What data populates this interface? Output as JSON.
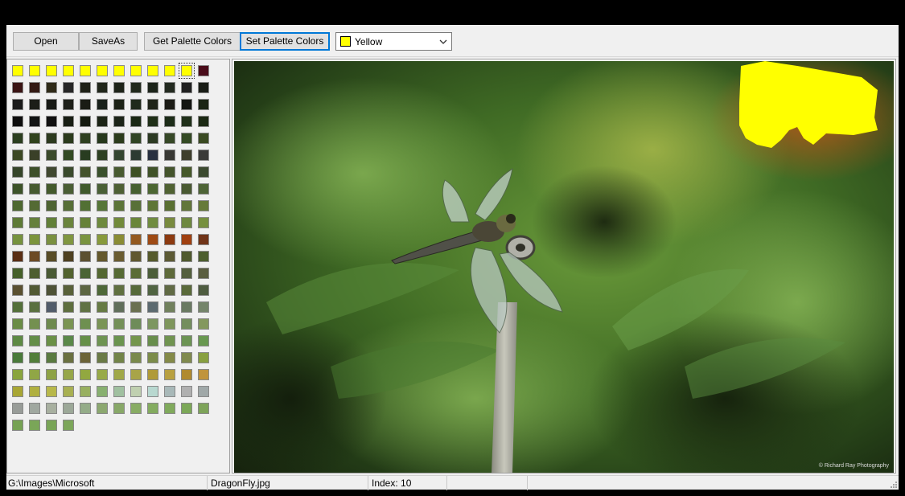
{
  "toolbar": {
    "open_label": "Open",
    "saveas_label": "SaveAs",
    "get_palette_label": "Get Palette Colors",
    "set_palette_label": "Set Palette Colors",
    "color_select": {
      "value": "Yellow",
      "swatch": "#ffff00",
      "icon": "chevron-down-icon"
    }
  },
  "palette": {
    "columns": 12,
    "selected_index": 10,
    "colors": [
      "#ffff00",
      "#ffff00",
      "#ffff00",
      "#ffff00",
      "#ffff00",
      "#ffff00",
      "#ffff00",
      "#ffff00",
      "#ffff00",
      "#ffff00",
      "#ffff00",
      "#4a0c1a",
      "#3a1414",
      "#341a14",
      "#2f2a18",
      "#262626",
      "#1f2117",
      "#20261a",
      "#1e2419",
      "#222a1c",
      "#1c241a",
      "#232a20",
      "#202020",
      "#191d16",
      "#1b1b1b",
      "#1c1e18",
      "#181a16",
      "#1e2019",
      "#1a1c15",
      "#18201a",
      "#1c2216",
      "#202a1c",
      "#1f2419",
      "#1c1c16",
      "#141612",
      "#1a2414",
      "#0e0e0e",
      "#121414",
      "#101010",
      "#181e14",
      "#141a10",
      "#1c2416",
      "#1c2418",
      "#1a2814",
      "#203018",
      "#1c2c18",
      "#20301a",
      "#1c2a14",
      "#2b3e1f",
      "#30421d",
      "#2c3a1e",
      "#2a3a1c",
      "#2e4020",
      "#26381c",
      "#2c3c1c",
      "#304424",
      "#2c3a22",
      "#364826",
      "#344a24",
      "#3a4a22",
      "#3c4824",
      "#3a4028",
      "#3a4a2a",
      "#324a22",
      "#283c20",
      "#2e4022",
      "#344630",
      "#2c3a32",
      "#283040",
      "#383834",
      "#3e3e2c",
      "#3a3a38",
      "#36452a",
      "#3d4f2a",
      "#404830",
      "#3a4a2c",
      "#44522c",
      "#3a502c",
      "#485a30",
      "#3e5024",
      "#405228",
      "#44542c",
      "#46582a",
      "#3c4a30",
      "#3c5228",
      "#465a30",
      "#445a2c",
      "#4a5e34",
      "#405a2c",
      "#4a6036",
      "#4e6034",
      "#466030",
      "#4c6632",
      "#506232",
      "#4a5a32",
      "#4e6436",
      "#4e6830",
      "#546a34",
      "#4e6432",
      "#566e36",
      "#527034",
      "#567638",
      "#5c7438",
      "#587038",
      "#5e7636",
      "#5a7032",
      "#62763a",
      "#667a38",
      "#5e7a36",
      "#66803c",
      "#628038",
      "#6a843c",
      "#668238",
      "#6e8a3e",
      "#728a3a",
      "#6a863a",
      "#708c40",
      "#788a3e",
      "#6e8840",
      "#76903e",
      "#76923e",
      "#7c943c",
      "#7a9040",
      "#809640",
      "#7a9440",
      "#889a3c",
      "#8a8c34",
      "#945a20",
      "#9e4a14",
      "#8c3a10",
      "#a04010",
      "#703418",
      "#5a2e14",
      "#6c4a24",
      "#584c26",
      "#4e4020",
      "#5c5030",
      "#64582c",
      "#6a5c30",
      "#605830",
      "#565a2c",
      "#5c5a34",
      "#505a2e",
      "#4c5e2e",
      "#46602a",
      "#4e5e30",
      "#4a5a34",
      "#52622e",
      "#4a6434",
      "#546832",
      "#566a34",
      "#5a6c36",
      "#4c5e3a",
      "#5e6a3a",
      "#54603e",
      "#5a5e40",
      "#5a5030",
      "#525a34",
      "#4e5236",
      "#586038",
      "#5c6642",
      "#4e6838",
      "#607040",
      "#566a3a",
      "#506442",
      "#606a44",
      "#5a6a3a",
      "#4e5c40",
      "#54703a",
      "#5a7040",
      "#525c6a",
      "#5e6e3e",
      "#607244",
      "#667a44",
      "#606e5a",
      "#6a7050",
      "#5c6a70",
      "#70805c",
      "#6a7a62",
      "#74846a",
      "#6a8c46",
      "#749050",
      "#6e8a4e",
      "#7a9452",
      "#6e9050",
      "#7a9456",
      "#749058",
      "#6e8c5a",
      "#7c9660",
      "#7e965c",
      "#748e5e",
      "#84985e",
      "#5e8a44",
      "#648e48",
      "#6a9046",
      "#5a8848",
      "#669048",
      "#6e9452",
      "#6a944e",
      "#74964c",
      "#688e4c",
      "#709450",
      "#6c9454",
      "#689850",
      "#4a7a3a",
      "#527e3a",
      "#5a7a40",
      "#6a7040",
      "#6c6438",
      "#6a7a46",
      "#728448",
      "#7a8a4c",
      "#7c8c4a",
      "#848a48",
      "#808a4e",
      "#88a040",
      "#8aa43e",
      "#90a646",
      "#8ea244",
      "#96a648",
      "#92a840",
      "#98aa48",
      "#a0a848",
      "#a8a448",
      "#b09a38",
      "#b8a040",
      "#b08a30",
      "#c0943c",
      "#a8a634",
      "#b0b040",
      "#b8b84a",
      "#a8b052",
      "#98b060",
      "#88b070",
      "#a0c0a0",
      "#c0d0b0",
      "#b8d8d0",
      "#a8b8b8",
      "#b0b0b0",
      "#a0a8a8",
      "#989c98",
      "#a0a8a0",
      "#a8b0a0",
      "#9ca898",
      "#94ac88",
      "#8ca870",
      "#88a868",
      "#88ac64",
      "#84ac60",
      "#80aa5c",
      "#7ca858",
      "#7ea45a",
      "#76a254",
      "#7aa658",
      "#78a456",
      "#7ca65a"
    ]
  },
  "image": {
    "watermark": "© Richard Ray Photography"
  },
  "status": {
    "path": "G:\\Images\\Microsoft",
    "file": "DragonFly.jpg",
    "index": "Index: 10",
    "extra": ""
  }
}
